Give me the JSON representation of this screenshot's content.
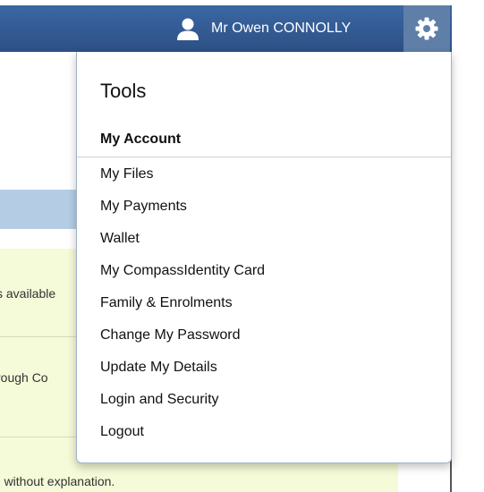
{
  "header": {
    "user_name": "Mr Owen CONNOLLY",
    "user_icon": "user-icon",
    "settings_icon": "gear-icon",
    "background_color": "#2c5085",
    "settings_button_color": "#5f7fa8"
  },
  "background": {
    "snippet_1": "s available",
    "snippet_2": "rough Co",
    "snippet_3": "' without explanation.",
    "highlight_color": "#f5fad8",
    "strip_color": "#b4cde4"
  },
  "menu": {
    "title": "Tools",
    "section_heading": "My Account",
    "items": [
      {
        "label": "My Files"
      },
      {
        "label": "My Payments"
      },
      {
        "label": "Wallet"
      },
      {
        "label": "My CompassIdentity Card"
      },
      {
        "label": "Family & Enrolments"
      },
      {
        "label": "Change My Password"
      },
      {
        "label": "Update My Details"
      },
      {
        "label": "Login and Security"
      },
      {
        "label": "Logout"
      }
    ]
  }
}
